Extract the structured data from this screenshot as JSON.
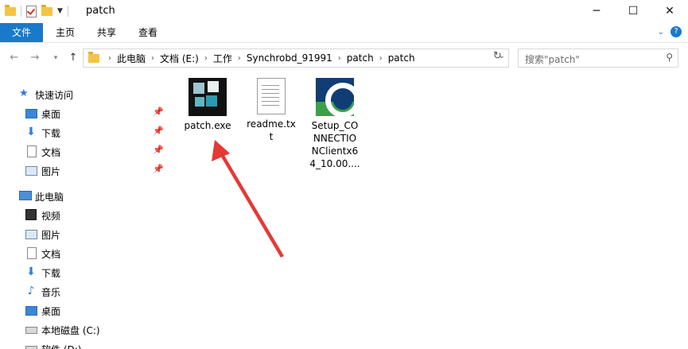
{
  "window": {
    "title": "patch",
    "controls": [
      "minimize-icon",
      "maximize-icon",
      "close-icon"
    ]
  },
  "ribbon": {
    "tabs": [
      {
        "label": "文件"
      },
      {
        "label": "主页"
      },
      {
        "label": "共享"
      },
      {
        "label": "查看"
      }
    ]
  },
  "address": {
    "crumbs": [
      "此电脑",
      "文档 (E:)",
      "工作",
      "Synchrobd_91991",
      "patch",
      "patch"
    ]
  },
  "search": {
    "placeholder": "搜索\"patch\""
  },
  "sidebar": {
    "quick_access": {
      "label": "快速访问",
      "items": [
        {
          "label": "桌面",
          "icon": "desktop-icon",
          "pinned": true
        },
        {
          "label": "下载",
          "icon": "download-icon",
          "pinned": true
        },
        {
          "label": "文档",
          "icon": "document-icon",
          "pinned": true
        },
        {
          "label": "图片",
          "icon": "picture-icon",
          "pinned": true
        }
      ]
    },
    "this_pc": {
      "label": "此电脑",
      "items": [
        {
          "label": "视频",
          "icon": "video-icon"
        },
        {
          "label": "图片",
          "icon": "picture-icon"
        },
        {
          "label": "文档",
          "icon": "document-icon"
        },
        {
          "label": "下载",
          "icon": "download-icon"
        },
        {
          "label": "音乐",
          "icon": "music-icon"
        },
        {
          "label": "桌面",
          "icon": "desktop-icon"
        },
        {
          "label": "本地磁盘 (C:)",
          "icon": "drive-icon"
        },
        {
          "label": "软件 (D:)",
          "icon": "drive-icon"
        }
      ]
    }
  },
  "files": [
    {
      "name_lines": [
        "patch.exe"
      ],
      "icon": "exe-icon"
    },
    {
      "name_lines": [
        "readme.tx",
        "t"
      ],
      "icon": "text-file-icon"
    },
    {
      "name_lines": [
        "Setup_CO",
        "NNECTIO",
        "NClientx6",
        "4_10.00...."
      ],
      "icon": "setup-icon"
    }
  ],
  "colors": {
    "accent": "#1979ca",
    "annotation_arrow": "#e53935"
  }
}
